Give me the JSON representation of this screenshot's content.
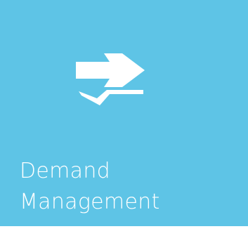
{
  "tile": {
    "label_line1": "Demand",
    "label_line2": "Management",
    "icon": "demand-management-icon",
    "background_color": "#5ec4e6",
    "text_color": "#ffffff"
  }
}
